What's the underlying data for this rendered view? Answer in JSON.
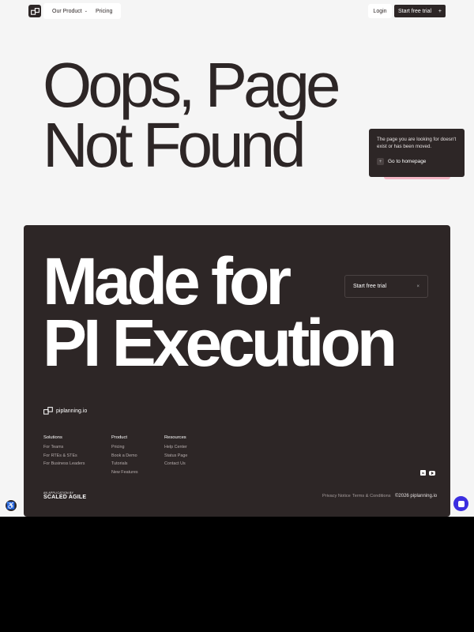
{
  "nav": {
    "logo_icon": "logo-mark-icon",
    "links": [
      {
        "label": "Our Product",
        "has_chevron": true
      },
      {
        "label": "Pricing",
        "has_chevron": false
      }
    ],
    "login_label": "Login",
    "trial_label": "Start free trial",
    "trial_icon": "plus"
  },
  "hero": {
    "title_line1": "Oops, Page",
    "title_line2": "Not Found",
    "notice_text": "The page you are looking for doesn't exist or has been moved.",
    "notice_link": "Go to homepage",
    "notice_link_glyph": "+"
  },
  "panel": {
    "title_line1": "Made for",
    "title_line2": "PI Execution",
    "cta_label": "Start free trial",
    "cta_glyph": "×",
    "brand": "piplanning.io",
    "columns": [
      {
        "head": "Solutions",
        "links": [
          "For Teams",
          "For RTEs & STEs",
          "For Business Leaders"
        ]
      },
      {
        "head": "Product",
        "links": [
          "Pricing",
          "Book a Demo",
          "Tutorials",
          "New Features"
        ]
      },
      {
        "head": "Resources",
        "links": [
          "Help Center",
          "Status Page",
          "Contact Us"
        ]
      }
    ],
    "social_linkedin": "in",
    "app_by_small": "AN APPLICATION BY",
    "app_by_big": "SCALED AGILE",
    "legal": [
      "Privacy Notice",
      "Terms & Conditions"
    ],
    "copyright": "©2026 piplanning.io"
  },
  "colors": {
    "dark": "#2d2626",
    "background": "#f5f5f5",
    "accent_pink": "#f4b5c4",
    "chat_blue": "#3b2ee0"
  }
}
